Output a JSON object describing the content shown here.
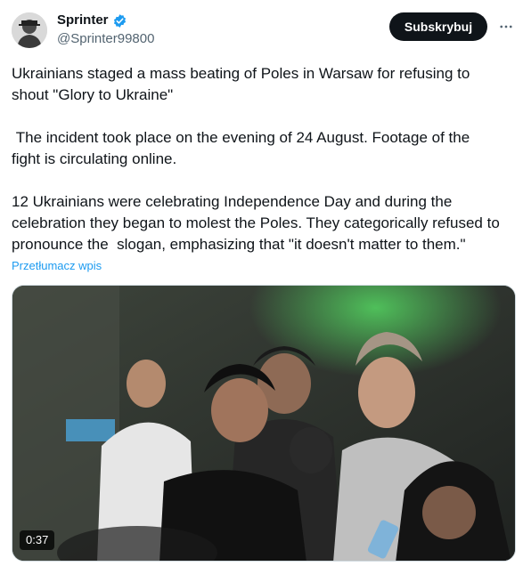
{
  "author": {
    "name": "Sprinter",
    "handle": "@Sprinter99800",
    "verified_icon": "verified-badge-icon",
    "avatar_icon": "avatar"
  },
  "actions": {
    "subscribe_label": "Subskrybuj",
    "more_icon": "more-horizontal-icon"
  },
  "post": {
    "paragraph1": "Ukrainians staged a mass beating of Poles in Warsaw for refusing to\nshout \"Glory to Ukraine\"",
    "paragraph2": " The incident took place on the evening of 24 August. Footage of the\nfight is circulating online.",
    "paragraph3": "12 Ukrainians were celebrating Independence Day and during the\ncelebration they began to molest the Poles. They categorically refused to\npronounce the  slogan, emphasizing that \"it doesn't matter to them.\"",
    "translate_label": "Przetłumacz wpis"
  },
  "media": {
    "type": "video",
    "duration": "0:37"
  },
  "colors": {
    "accent": "#1d9bf0",
    "button_bg": "#0f1419",
    "secondary_text": "#536471"
  }
}
